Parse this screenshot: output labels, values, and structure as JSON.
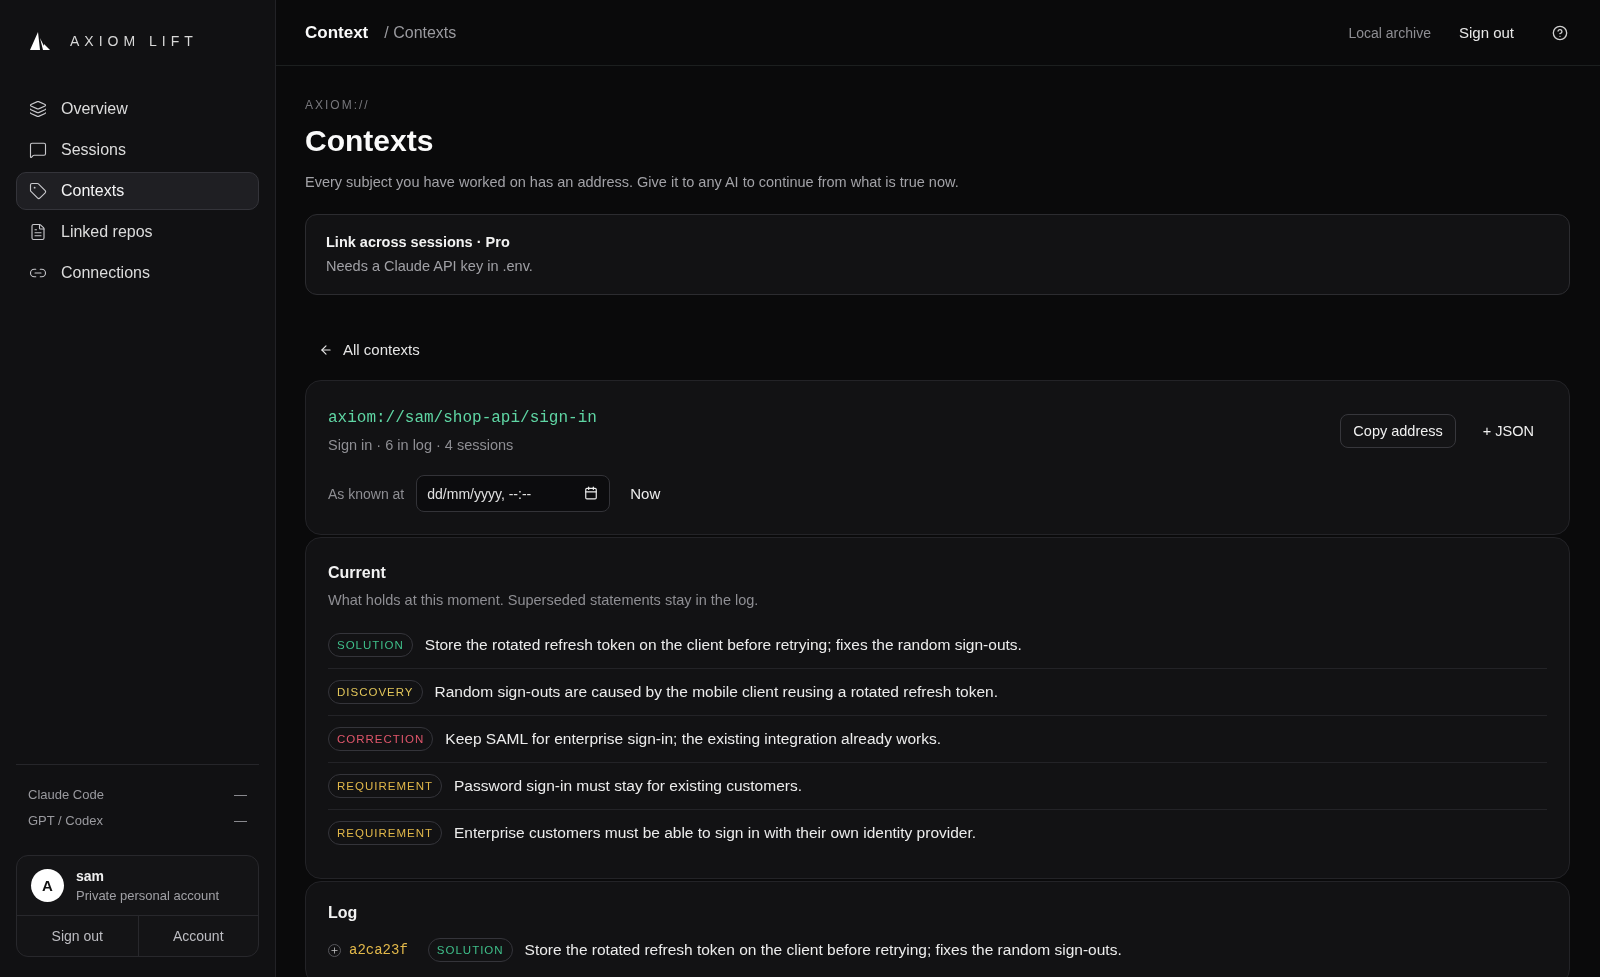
{
  "brand": {
    "name": "AXIOM LIFT"
  },
  "sidebar": {
    "items": [
      {
        "label": "Overview",
        "selected": false
      },
      {
        "label": "Sessions",
        "selected": false
      },
      {
        "label": "Contexts",
        "selected": true
      },
      {
        "label": "Linked repos",
        "selected": false
      },
      {
        "label": "Connections",
        "selected": false
      }
    ],
    "connections": [
      {
        "name": "Claude Code",
        "status": "—"
      },
      {
        "name": "GPT / Codex",
        "status": "—"
      }
    ],
    "account": {
      "initial": "A",
      "name": "sam",
      "description": "Private personal account",
      "actions": [
        "Sign out",
        "Account"
      ]
    }
  },
  "header": {
    "breadcrumb": "Context",
    "breadcrumb_sub": "/ Contexts",
    "links": [
      "Local archive",
      "Sign out"
    ]
  },
  "page": {
    "eyebrow": "AXIOM://",
    "title": "Contexts",
    "description": "Every subject you have worked on has an address. Give it to any AI to continue from what is true now."
  },
  "notice": {
    "title": "Link across sessions · Pro",
    "text": "Needs a Claude API key in .env."
  },
  "back_link": "All contexts",
  "context": {
    "address": "axiom://sam/shop-api/sign-in",
    "meta": "Sign in · 6 in log · 4 sessions",
    "buttons": [
      "Copy address",
      "+ JSON"
    ],
    "as_known_at": {
      "label": "As known at",
      "placeholder": "dd/mm/yyyy, --:--",
      "now": "Now"
    }
  },
  "current": {
    "title": "Current",
    "description": "What holds at this moment. Superseded statements stay in the log.",
    "items": [
      {
        "kind": "solution",
        "tag": "SOLUTION",
        "text": "Store the rotated refresh token on the client before retrying; fixes the random sign-outs."
      },
      {
        "kind": "discovery",
        "tag": "DISCOVERY",
        "text": "Random sign-outs are caused by the mobile client reusing a rotated refresh token."
      },
      {
        "kind": "correction",
        "tag": "CORRECTION",
        "text": "Keep SAML for enterprise sign-in; the existing integration already works."
      },
      {
        "kind": "requirement",
        "tag": "REQUIREMENT",
        "text": "Password sign-in must stay for existing customers."
      },
      {
        "kind": "requirement",
        "tag": "REQUIREMENT",
        "text": "Enterprise customers must be able to sign in with their own identity provider."
      }
    ]
  },
  "log": {
    "title": "Log",
    "items": [
      {
        "kind": "solution",
        "hash": "a2ca23f",
        "tag": "SOLUTION",
        "text": "Store the rotated refresh token on the client before retrying; fixes the random sign-outs.",
        "expanded": false
      }
    ]
  }
}
